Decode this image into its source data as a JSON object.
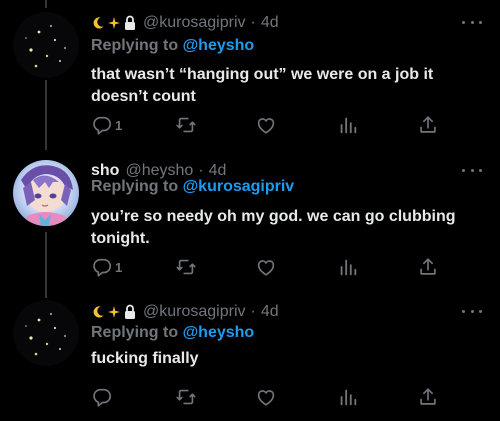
{
  "tweets": [
    {
      "emoji": [
        "moon",
        "sparkles",
        "lock"
      ],
      "display_name": "",
      "handle": "@kurosagipriv",
      "separator": "·",
      "time": "4d",
      "replying_label": "Replying to",
      "replying_to": "@heysho",
      "text": "that wasn’t “hanging out” we were on a job it doesn’t count",
      "reply_count": "1",
      "retweet_count": "",
      "like_count": ""
    },
    {
      "emoji": [],
      "display_name": "sho",
      "handle": "@heysho",
      "separator": "·",
      "time": "4d",
      "replying_label": "Replying to",
      "replying_to": "@kurosagipriv",
      "text": "you’re so needy oh my god. we can go clubbing tonight.",
      "reply_count": "1",
      "retweet_count": "",
      "like_count": ""
    },
    {
      "emoji": [
        "moon",
        "sparkles",
        "lock"
      ],
      "display_name": "",
      "handle": "@kurosagipriv",
      "separator": "·",
      "time": "4d",
      "replying_label": "Replying to",
      "replying_to": "@heysho",
      "text": "fucking finally",
      "reply_count": "",
      "retweet_count": "",
      "like_count": ""
    }
  ],
  "icons": {
    "reply": "reply-icon",
    "retweet": "retweet-icon",
    "like": "heart-icon",
    "views": "views-icon",
    "share": "share-icon",
    "more": "more-icon"
  },
  "colors": {
    "background": "#000000",
    "text": "#e7e9ea",
    "secondary": "#71767b",
    "accent": "#1d9bf0",
    "thread_line": "#333639"
  }
}
